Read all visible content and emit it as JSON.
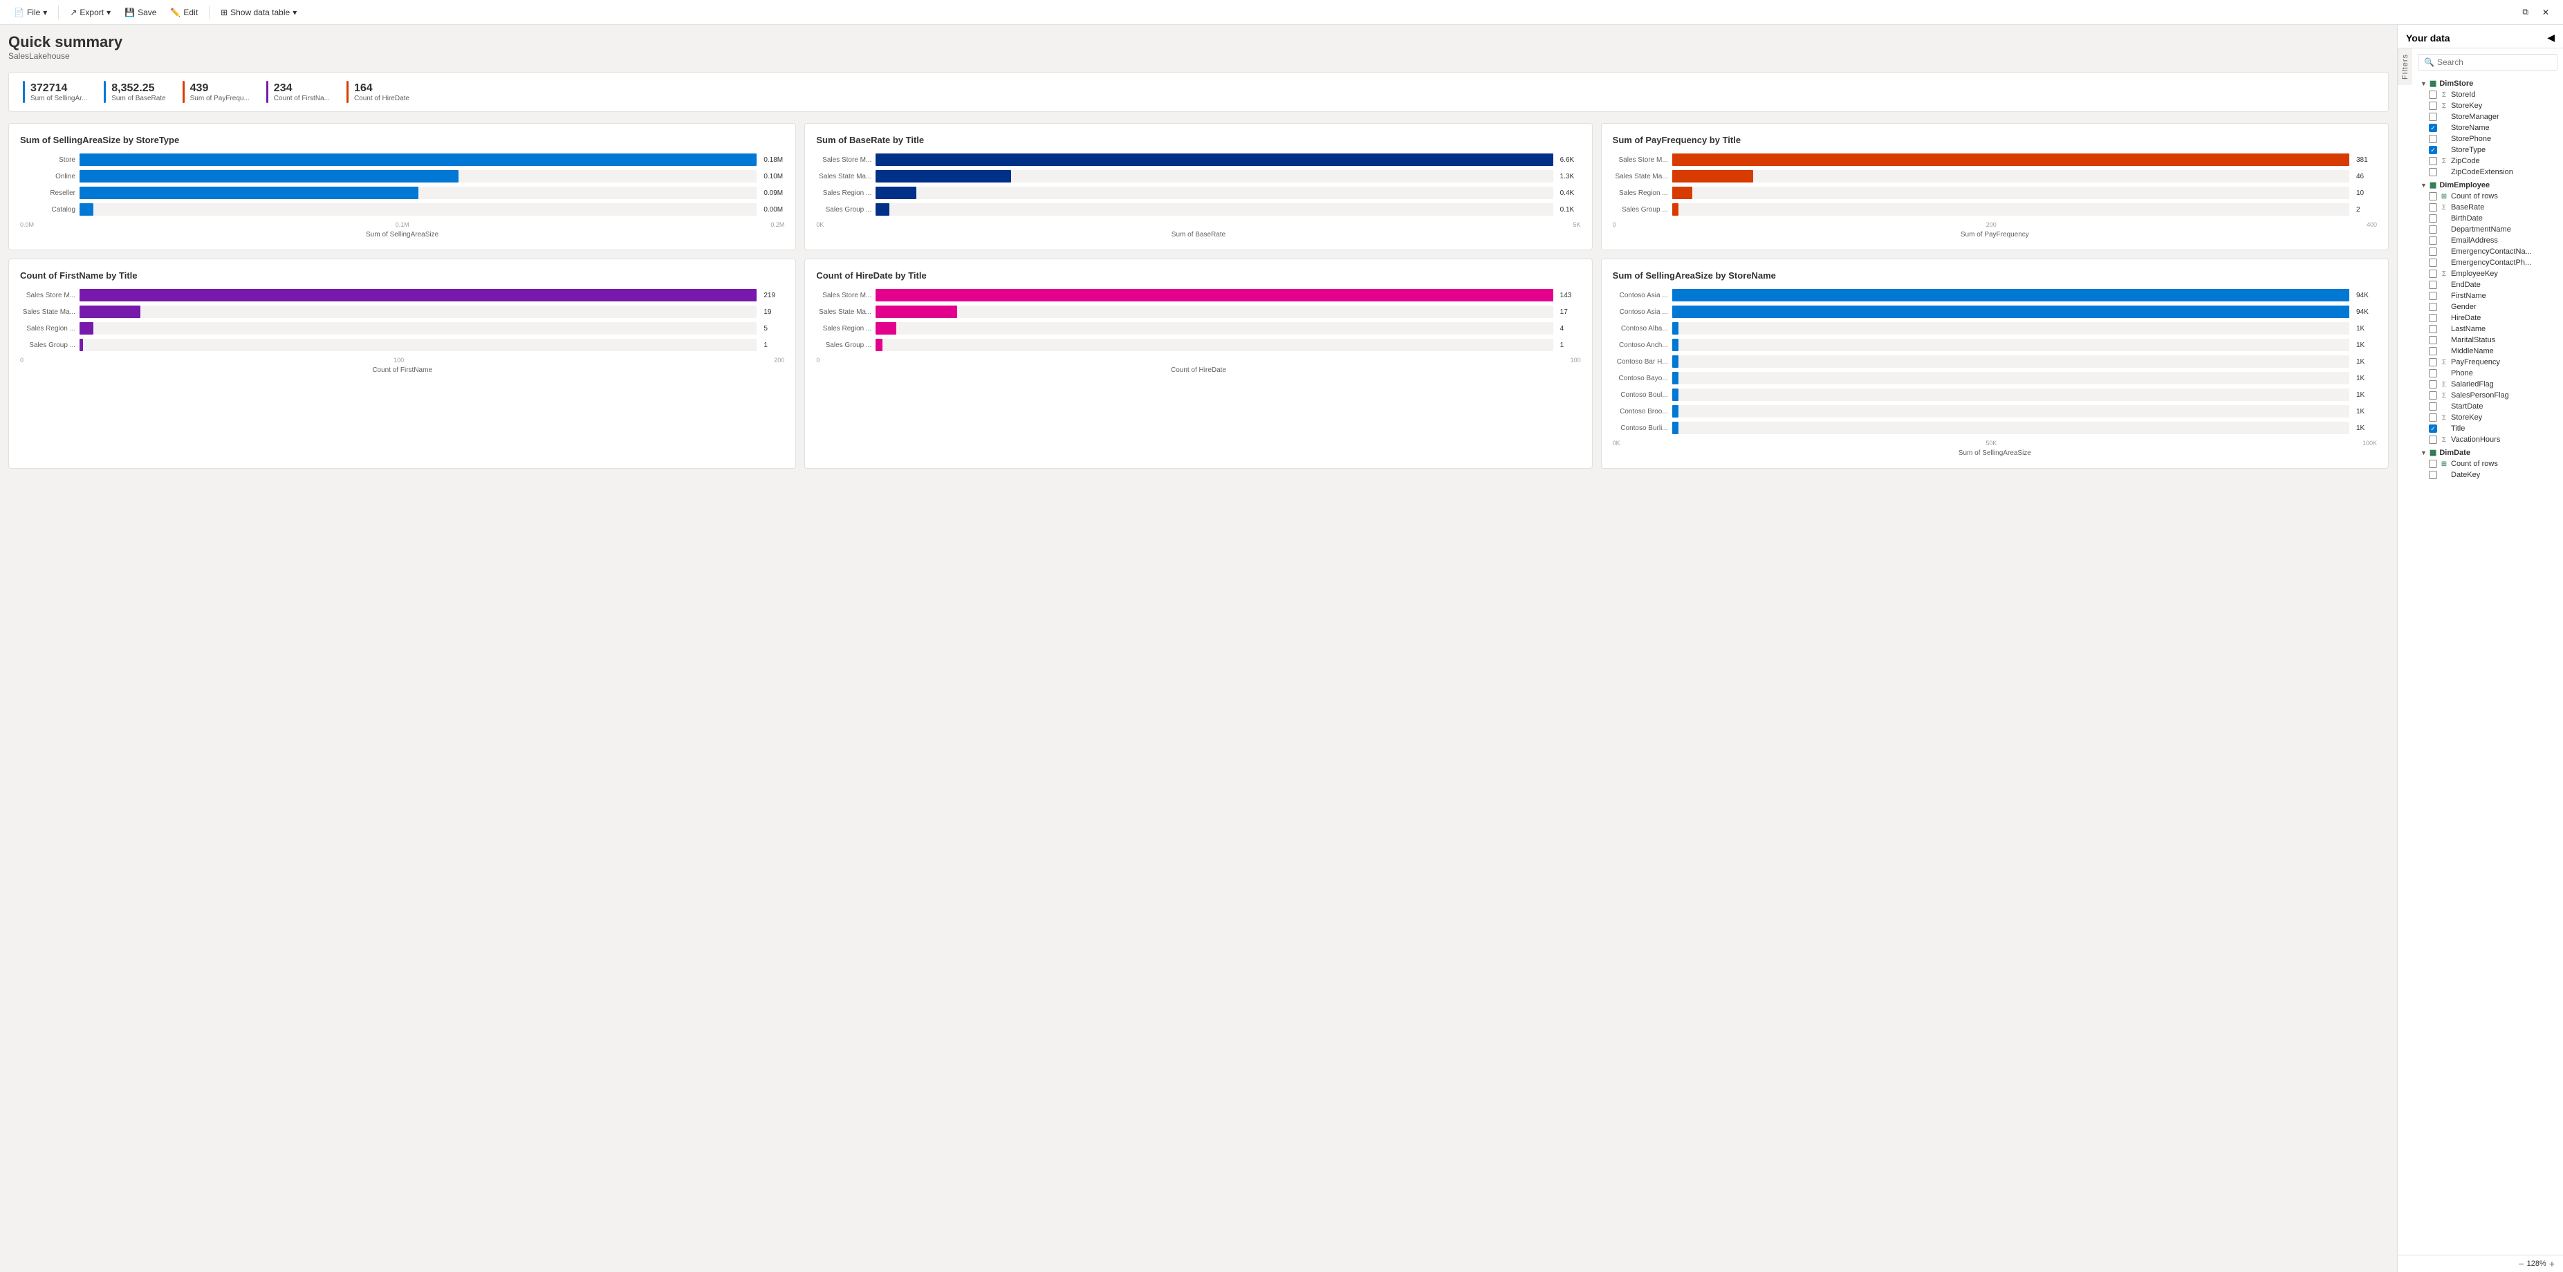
{
  "toolbar": {
    "file_label": "File",
    "export_label": "Export",
    "save_label": "Save",
    "edit_label": "Edit",
    "show_data_table_label": "Show data table"
  },
  "page": {
    "title": "Quick summary",
    "subtitle": "SalesLakehouse"
  },
  "kpis": [
    {
      "value": "372714",
      "label": "Sum of SellingAr...",
      "color": "#0078d4"
    },
    {
      "value": "8,352.25",
      "label": "Sum of BaseRate",
      "color": "#0078d4"
    },
    {
      "value": "439",
      "label": "Sum of PayFrequ...",
      "color": "#d83b01"
    },
    {
      "value": "234",
      "label": "Count of FirstNa...",
      "color": "#7719aa"
    },
    {
      "value": "164",
      "label": "Count of HireDate",
      "color": "#d83b01"
    }
  ],
  "charts": [
    {
      "id": "chart1",
      "title": "Sum of SellingAreaSize by StoreType",
      "x_label": "Sum of SellingAreaSize",
      "y_label": "StoreType",
      "color": "#0078d4",
      "bars": [
        {
          "label": "Store",
          "value": 0.18,
          "display": "0.18M",
          "pct": 100
        },
        {
          "label": "Online",
          "value": 0.1,
          "display": "0.10M",
          "pct": 56
        },
        {
          "label": "Reseller",
          "value": 0.09,
          "display": "0.09M",
          "pct": 50
        },
        {
          "label": "Catalog",
          "value": 0.0,
          "display": "0.00M",
          "pct": 2
        }
      ],
      "x_ticks": [
        "0.0M",
        "0.1M",
        "0.2M"
      ]
    },
    {
      "id": "chart2",
      "title": "Sum of BaseRate by Title",
      "x_label": "Sum of BaseRate",
      "y_label": "Title",
      "color": "#003087",
      "bars": [
        {
          "label": "Sales Store M...",
          "value": 6600,
          "display": "6.6K",
          "pct": 100
        },
        {
          "label": "Sales State Ma...",
          "value": 1300,
          "display": "1.3K",
          "pct": 20
        },
        {
          "label": "Sales Region ...",
          "value": 400,
          "display": "0.4K",
          "pct": 6
        },
        {
          "label": "Sales Group ...",
          "value": 100,
          "display": "0.1K",
          "pct": 2
        }
      ],
      "x_ticks": [
        "0K",
        "5K"
      ]
    },
    {
      "id": "chart3",
      "title": "Sum of PayFrequency by Title",
      "x_label": "Sum of PayFrequency",
      "y_label": "Title",
      "color": "#d83b01",
      "bars": [
        {
          "label": "Sales Store M...",
          "value": 381,
          "display": "381",
          "pct": 100
        },
        {
          "label": "Sales State Ma...",
          "value": 46,
          "display": "46",
          "pct": 12
        },
        {
          "label": "Sales Region ...",
          "value": 10,
          "display": "10",
          "pct": 3
        },
        {
          "label": "Sales Group ...",
          "value": 2,
          "display": "2",
          "pct": 1
        }
      ],
      "x_ticks": [
        "0",
        "200",
        "400"
      ]
    },
    {
      "id": "chart4",
      "title": "Count of FirstName by Title",
      "x_label": "Count of FirstName",
      "y_label": "Title",
      "color": "#7719aa",
      "bars": [
        {
          "label": "Sales Store M...",
          "value": 219,
          "display": "219",
          "pct": 100
        },
        {
          "label": "Sales State Ma...",
          "value": 19,
          "display": "19",
          "pct": 9
        },
        {
          "label": "Sales Region ...",
          "value": 5,
          "display": "5",
          "pct": 2
        },
        {
          "label": "Sales Group ...",
          "value": 1,
          "display": "1",
          "pct": 0.5
        }
      ],
      "x_ticks": [
        "0",
        "100",
        "200"
      ]
    },
    {
      "id": "chart5",
      "title": "Count of HireDate by Title",
      "x_label": "Count of HireDate",
      "y_label": "Title",
      "color": "#e3008c",
      "bars": [
        {
          "label": "Sales Store M...",
          "value": 143,
          "display": "143",
          "pct": 100
        },
        {
          "label": "Sales State Ma...",
          "value": 17,
          "display": "17",
          "pct": 12
        },
        {
          "label": "Sales Region ...",
          "value": 4,
          "display": "4",
          "pct": 3
        },
        {
          "label": "Sales Group ...",
          "value": 1,
          "display": "1",
          "pct": 1
        }
      ],
      "x_ticks": [
        "0",
        "100"
      ]
    },
    {
      "id": "chart6",
      "title": "Sum of SellingAreaSize by StoreName",
      "x_label": "Sum of SellingAreaSize",
      "y_label": "StoreName",
      "color": "#0078d4",
      "bars": [
        {
          "label": "Contoso Asia ...",
          "value": 94000,
          "display": "94K",
          "pct": 100
        },
        {
          "label": "Contoso Asia ...",
          "value": 94000,
          "display": "94K",
          "pct": 100
        },
        {
          "label": "Contoso Alba...",
          "value": 1000,
          "display": "1K",
          "pct": 1
        },
        {
          "label": "Contoso Anch...",
          "value": 1000,
          "display": "1K",
          "pct": 1
        },
        {
          "label": "Contoso Bar H...",
          "value": 1000,
          "display": "1K",
          "pct": 1
        },
        {
          "label": "Contoso Bayo...",
          "value": 1000,
          "display": "1K",
          "pct": 1
        },
        {
          "label": "Contoso Boul...",
          "value": 1000,
          "display": "1K",
          "pct": 1
        },
        {
          "label": "Contoso Broo...",
          "value": 1000,
          "display": "1K",
          "pct": 1
        },
        {
          "label": "Contoso Burli...",
          "value": 1000,
          "display": "1K",
          "pct": 1
        }
      ],
      "x_ticks": [
        "0K",
        "50K",
        "100K"
      ]
    }
  ],
  "right_panel": {
    "title": "Your data",
    "search_placeholder": "Search",
    "filters_label": "Filters",
    "tree": {
      "groups": [
        {
          "name": "DimStore",
          "expanded": true,
          "items": [
            {
              "label": "StoreId",
              "type": "sigma",
              "checked": false
            },
            {
              "label": "StoreKey",
              "type": "sigma",
              "checked": false
            },
            {
              "label": "StoreManager",
              "type": "text",
              "checked": false
            },
            {
              "label": "StoreName",
              "type": "text",
              "checked": true
            },
            {
              "label": "StorePhone",
              "type": "text",
              "checked": false
            },
            {
              "label": "StoreType",
              "type": "text",
              "checked": true
            },
            {
              "label": "ZipCode",
              "type": "sigma",
              "checked": false
            },
            {
              "label": "ZipCodeExtension",
              "type": "text",
              "checked": false
            }
          ]
        },
        {
          "name": "DimEmployee",
          "expanded": true,
          "items": [
            {
              "label": "Count of rows",
              "type": "measure",
              "checked": false
            },
            {
              "label": "BaseRate",
              "type": "sigma",
              "checked": false
            },
            {
              "label": "BirthDate",
              "type": "text",
              "checked": false
            },
            {
              "label": "DepartmentName",
              "type": "text",
              "checked": false
            },
            {
              "label": "EmailAddress",
              "type": "text",
              "checked": false
            },
            {
              "label": "EmergencyContactNa...",
              "type": "text",
              "checked": false
            },
            {
              "label": "EmergencyContactPh...",
              "type": "text",
              "checked": false
            },
            {
              "label": "EmployeeKey",
              "type": "sigma",
              "checked": false
            },
            {
              "label": "EndDate",
              "type": "text",
              "checked": false
            },
            {
              "label": "FirstName",
              "type": "text",
              "checked": false
            },
            {
              "label": "Gender",
              "type": "text",
              "checked": false
            },
            {
              "label": "HireDate",
              "type": "text",
              "checked": false
            },
            {
              "label": "LastName",
              "type": "text",
              "checked": false
            },
            {
              "label": "MaritalStatus",
              "type": "text",
              "checked": false
            },
            {
              "label": "MiddleName",
              "type": "text",
              "checked": false
            },
            {
              "label": "PayFrequency",
              "type": "sigma",
              "checked": false
            },
            {
              "label": "Phone",
              "type": "text",
              "checked": false
            },
            {
              "label": "SalariedFlag",
              "type": "sigma",
              "checked": false
            },
            {
              "label": "SalesPersonFlag",
              "type": "sigma",
              "checked": false
            },
            {
              "label": "StartDate",
              "type": "text",
              "checked": false
            },
            {
              "label": "StoreKey",
              "type": "sigma",
              "checked": false
            },
            {
              "label": "Title",
              "type": "text",
              "checked": true
            },
            {
              "label": "VacationHours",
              "type": "sigma",
              "checked": false
            }
          ]
        },
        {
          "name": "DimDate",
          "expanded": true,
          "items": [
            {
              "label": "Count of rows",
              "type": "measure",
              "checked": false
            },
            {
              "label": "DateKey",
              "type": "text",
              "checked": false
            }
          ]
        }
      ]
    }
  },
  "bottom_bar": {
    "zoom_label": "128%"
  }
}
